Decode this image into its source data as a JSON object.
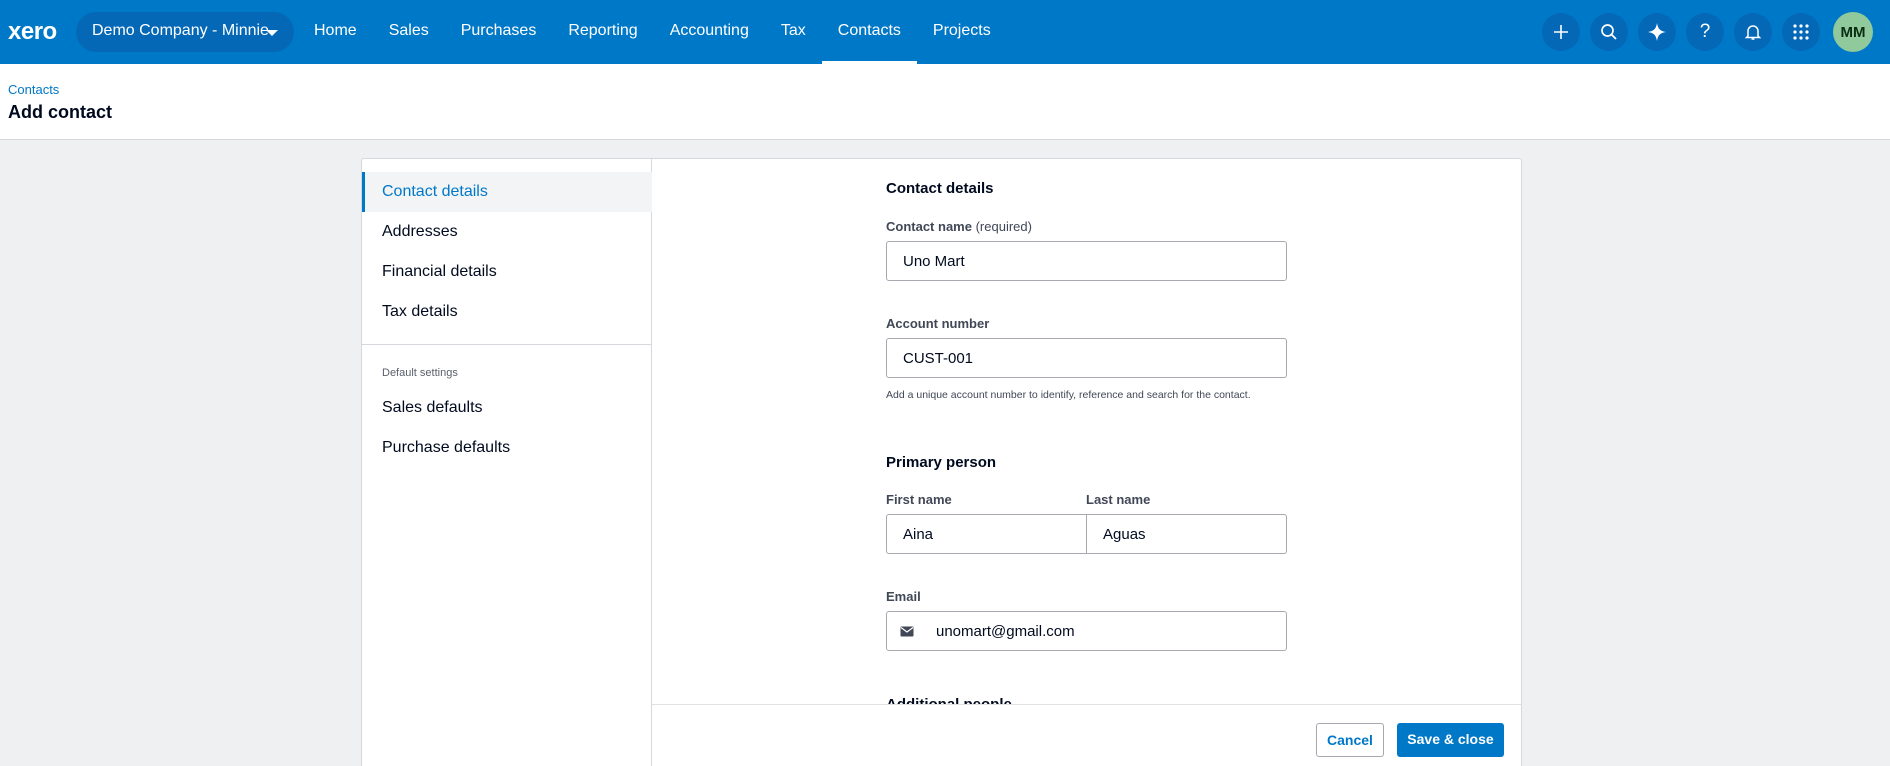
{
  "topbar": {
    "logo": "xero",
    "org_name": "Demo Company - Minnie",
    "nav": [
      {
        "label": "Home"
      },
      {
        "label": "Sales"
      },
      {
        "label": "Purchases"
      },
      {
        "label": "Reporting"
      },
      {
        "label": "Accounting"
      },
      {
        "label": "Tax"
      },
      {
        "label": "Contacts"
      },
      {
        "label": "Projects"
      }
    ],
    "active_nav": "Contacts",
    "icons": [
      "plus-icon",
      "search-icon",
      "sparkle-icon",
      "help-icon",
      "bell-icon",
      "apps-grid-icon"
    ],
    "avatar_initials": "MM",
    "colors": {
      "brand": "#0078c8",
      "avatar": "#8fc99c"
    }
  },
  "header": {
    "breadcrumb": "Contacts",
    "title": "Add contact"
  },
  "sidebar": {
    "items": [
      {
        "label": "Contact details",
        "active": true
      },
      {
        "label": "Addresses"
      },
      {
        "label": "Financial details"
      },
      {
        "label": "Tax details"
      }
    ],
    "section_label": "Default settings",
    "default_items": [
      {
        "label": "Sales defaults"
      },
      {
        "label": "Purchase defaults"
      }
    ]
  },
  "form": {
    "contact_details_title": "Contact details",
    "contact_name_label": "Contact name",
    "contact_name_required": "(required)",
    "contact_name_value": "Uno Mart",
    "account_number_label": "Account number",
    "account_number_value": "CUST-001",
    "account_number_hint": "Add a unique account number to identify, reference and search for the contact.",
    "primary_person_title": "Primary person",
    "first_name_label": "First name",
    "first_name_value": "Aina",
    "last_name_label": "Last name",
    "last_name_value": "Aguas",
    "email_label": "Email",
    "email_value": "unomart@gmail.com",
    "additional_people_title": "Additional people"
  },
  "footer": {
    "cancel_label": "Cancel",
    "save_label": "Save & close"
  }
}
